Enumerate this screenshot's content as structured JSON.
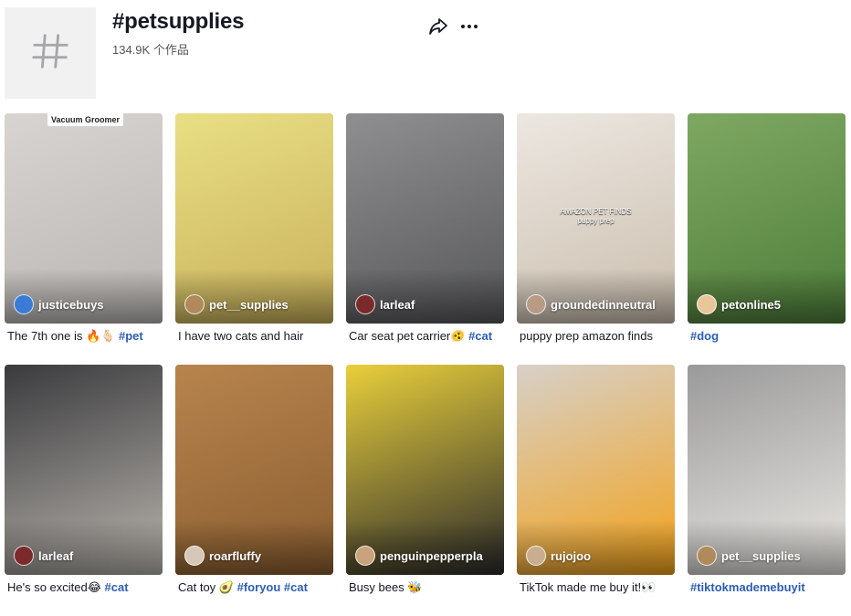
{
  "tag": {
    "title": "#petsupplies",
    "count": "134.9K 个作品",
    "icon": "hashtag-icon"
  },
  "actions": {
    "share_icon": "share-icon",
    "more_icon": "more-icon"
  },
  "videos": [
    {
      "author": "justicebuys",
      "caption_text": "The 7th one is 🔥🫰🏻 ",
      "caption_tag": "#pet",
      "overlay": "Vacuum Groomer",
      "colors": [
        "#d8d4d1",
        "#b9b6b3"
      ],
      "avatar": "#3a7bd5"
    },
    {
      "author": "pet__supplies",
      "caption_text": "I have two cats and hair",
      "caption_tag": "",
      "colors": [
        "#e8df84",
        "#c9b15a"
      ],
      "avatar": "#b08a5a"
    },
    {
      "author": "larleaf",
      "caption_text": "Car seat pet carrier🫨 ",
      "caption_tag": "#cat",
      "colors": [
        "#8f8f92",
        "#565759"
      ],
      "avatar": "#7a2a2a"
    },
    {
      "author": "groundedinneutral",
      "caption_text": "puppy prep amazon finds",
      "caption_tag": "",
      "overlay_mid": "AMAZON PET FINDS\npuppy prep",
      "colors": [
        "#ece7e1",
        "#cbbfae"
      ],
      "avatar": "#b89b85"
    },
    {
      "author": "petonline5",
      "caption_text": "",
      "caption_tag": "#dog",
      "colors": [
        "#7ea862",
        "#4f7e3a"
      ],
      "avatar": "#e8c69a"
    },
    {
      "author": "larleaf",
      "caption_text": "He's so excited😂 ",
      "caption_tag": "#cat",
      "colors": [
        "#3a3a3d",
        "#b9b5ae"
      ],
      "avatar": "#7a2a2a"
    },
    {
      "author": "roarfluffy",
      "caption_text": "Cat toy 🥑 ",
      "caption_tag": "#foryou #cat",
      "colors": [
        "#b7844d",
        "#8b5e30"
      ],
      "avatar": "#d6c7b8"
    },
    {
      "author": "penguinpepperpla",
      "caption_text": "Busy bees 🐝",
      "caption_tag": "",
      "colors": [
        "#e9cf3b",
        "#2b2b2b"
      ],
      "avatar": "#caa27c"
    },
    {
      "author": "rujojoo",
      "caption_text": "TikTok made me buy it!👀",
      "caption_tag": "",
      "colors": [
        "#d7d0c8",
        "#f3a21a"
      ],
      "avatar": "#c9ad8f"
    },
    {
      "author": "pet__supplies",
      "caption_text": "",
      "caption_tag": "#tiktokmademebuyit",
      "colors": [
        "#9a9a9a",
        "#ebe8e4"
      ],
      "avatar": "#b08a5a"
    }
  ]
}
